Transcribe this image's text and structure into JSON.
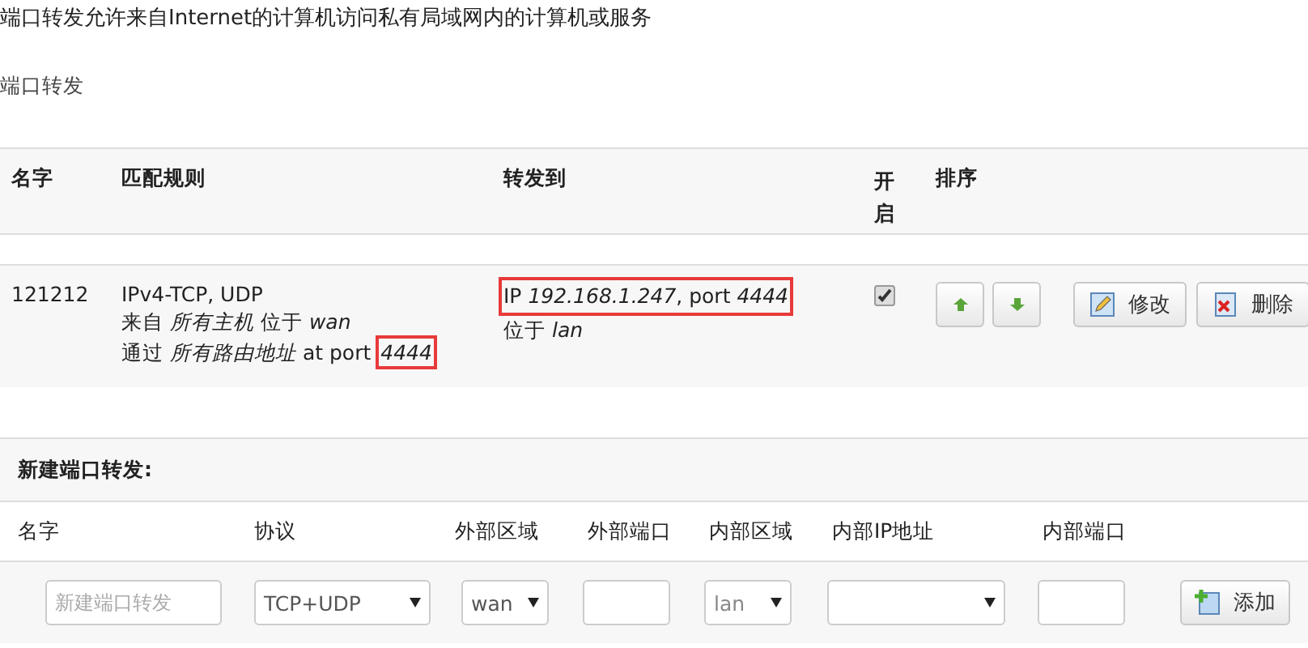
{
  "description": "端口转发允许来自Internet的计算机访问私有局域网内的计算机或服务",
  "section_title": "端口转发",
  "table": {
    "columns": [
      "名字",
      "匹配规则",
      "转发到",
      "开启",
      "排序"
    ],
    "rows": [
      {
        "name": "121212",
        "match": [
          {
            "text": "IPv4-TCP, UDP",
            "highlighted": false
          },
          {
            "text": "来自 *所有主机* 位于 *wan*",
            "highlighted": false
          }
        ],
        "match_last": {
          "text": "通过 *所有路由地址* at port",
          "port": "*4444*",
          "port_highlighted": true
        },
        "forward": {
          "target": "IP *192.168.1.247*, port *4444*",
          "target_highlighted": true,
          "zone": "位于 *lan*"
        },
        "enabled": true,
        "edit_label": "修改",
        "delete_label": "删除"
      }
    ]
  },
  "new_rule": {
    "title": "新建端口转发:",
    "columns": [
      "名字",
      "协议",
      "外部区域",
      "外部端口",
      "内部区域",
      "内部IP地址",
      "内部端口"
    ],
    "name_placeholder": "新建端口转发",
    "protocol": "TCP+UDP",
    "external_zone": "wan",
    "internal_zone": "lan",
    "add_label": "添加"
  }
}
